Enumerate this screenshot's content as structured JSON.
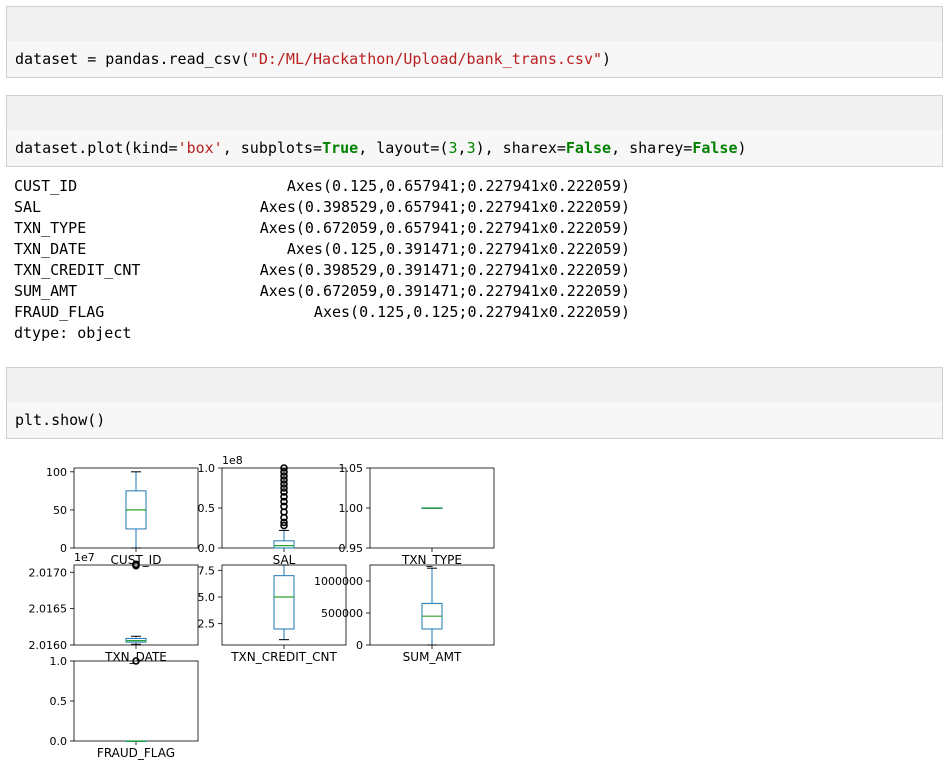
{
  "cells": [
    {
      "code_parts": [
        {
          "t": "dataset = pandas.read_csv(",
          "c": ""
        },
        {
          "t": "\"D:/ML/Hackathon/Upload/bank_trans.csv\"",
          "c": "str"
        },
        {
          "t": ")",
          "c": ""
        }
      ]
    },
    {
      "code_parts": [
        {
          "t": "dataset.plot(kind=",
          "c": ""
        },
        {
          "t": "'box'",
          "c": "str"
        },
        {
          "t": ", subplots=",
          "c": ""
        },
        {
          "t": "True",
          "c": "kw"
        },
        {
          "t": ", layout=(",
          "c": ""
        },
        {
          "t": "3",
          "c": "num"
        },
        {
          "t": ",",
          "c": ""
        },
        {
          "t": "3",
          "c": "num"
        },
        {
          "t": "), sharex=",
          "c": ""
        },
        {
          "t": "False",
          "c": "kw"
        },
        {
          "t": ", sharey=",
          "c": ""
        },
        {
          "t": "False",
          "c": "kw"
        },
        {
          "t": ")",
          "c": ""
        }
      ]
    },
    {
      "code_parts": [
        {
          "t": "plt.show()",
          "c": ""
        }
      ]
    }
  ],
  "output": {
    "rows": [
      {
        "key": "CUST_ID",
        "value": "Axes(0.125,0.657941;0.227941x0.222059)"
      },
      {
        "key": "SAL",
        "value": "Axes(0.398529,0.657941;0.227941x0.222059)"
      },
      {
        "key": "TXN_TYPE",
        "value": "Axes(0.672059,0.657941;0.227941x0.222059)"
      },
      {
        "key": "TXN_DATE",
        "value": "Axes(0.125,0.391471;0.227941x0.222059)"
      },
      {
        "key": "TXN_CREDIT_CNT",
        "value": "Axes(0.398529,0.391471;0.227941x0.222059)"
      },
      {
        "key": "SUM_AMT",
        "value": "Axes(0.672059,0.391471;0.227941x0.222059)"
      },
      {
        "key": "FRAUD_FLAG",
        "value": "Axes(0.125,0.125;0.227941x0.222059)"
      }
    ],
    "dtype": "dtype: object"
  },
  "chart_data": [
    {
      "type": "box",
      "xlabel": "CUST_ID",
      "offset_label": "",
      "yticks": [
        "0",
        "50",
        "100"
      ],
      "ylim": [
        0,
        105
      ],
      "box": {
        "whislo": 0,
        "q1": 25,
        "median": 50,
        "q3": 75,
        "whishi": 100
      },
      "fliers": []
    },
    {
      "type": "box",
      "xlabel": "SAL",
      "offset_label": "1e8",
      "yticks": [
        "0.0",
        "0.5",
        "1.0"
      ],
      "ylim": [
        0,
        1.0
      ],
      "box": {
        "whislo": 0,
        "q1": 0,
        "median": 0.03,
        "q3": 0.09,
        "whishi": 0.22
      },
      "fliers": [
        0.28,
        0.32,
        0.38,
        0.45,
        0.52,
        0.58,
        0.64,
        0.7,
        0.75,
        0.8,
        0.85,
        0.9,
        0.95,
        1.0
      ]
    },
    {
      "type": "box",
      "xlabel": "TXN_TYPE",
      "offset_label": "",
      "yticks": [
        "0.95",
        "1.00",
        "1.05"
      ],
      "ylim": [
        0.95,
        1.05
      ],
      "box": {
        "whislo": 1,
        "q1": 1,
        "median": 1,
        "q3": 1,
        "whishi": 1
      },
      "fliers": []
    },
    {
      "type": "box",
      "xlabel": "TXN_DATE",
      "offset_label": "1e7",
      "yticks": [
        "2.0160",
        "2.0165",
        "2.0170"
      ],
      "ylim": [
        2.016,
        2.0171
      ],
      "box": {
        "whislo": 2.01601,
        "q1": 2.01604,
        "median": 2.01606,
        "q3": 2.01609,
        "whishi": 2.01612
      },
      "fliers": [
        2.01709,
        2.01711
      ]
    },
    {
      "type": "box",
      "xlabel": "TXN_CREDIT_CNT",
      "offset_label": "",
      "yticks": [
        "2.5",
        "5.0",
        "7.5"
      ],
      "ylim": [
        0.5,
        8
      ],
      "box": {
        "whislo": 1,
        "q1": 2,
        "median": 5,
        "q3": 7,
        "whishi": 8
      },
      "fliers": []
    },
    {
      "type": "box",
      "xlabel": "SUM_AMT",
      "offset_label": "",
      "yticks": [
        "0",
        "500000",
        "1000000"
      ],
      "ylim": [
        0,
        1250000
      ],
      "box": {
        "whislo": 0,
        "q1": 250000,
        "median": 450000,
        "q3": 650000,
        "whishi": 1200000
      },
      "fliers": []
    },
    {
      "type": "box",
      "xlabel": "FRAUD_FLAG",
      "offset_label": "",
      "yticks": [
        "0.0",
        "0.5",
        "1.0"
      ],
      "ylim": [
        0,
        1.0
      ],
      "box": {
        "whislo": 0,
        "q1": 0,
        "median": 0,
        "q3": 0,
        "whishi": 0
      },
      "fliers": [
        1.0
      ]
    }
  ]
}
